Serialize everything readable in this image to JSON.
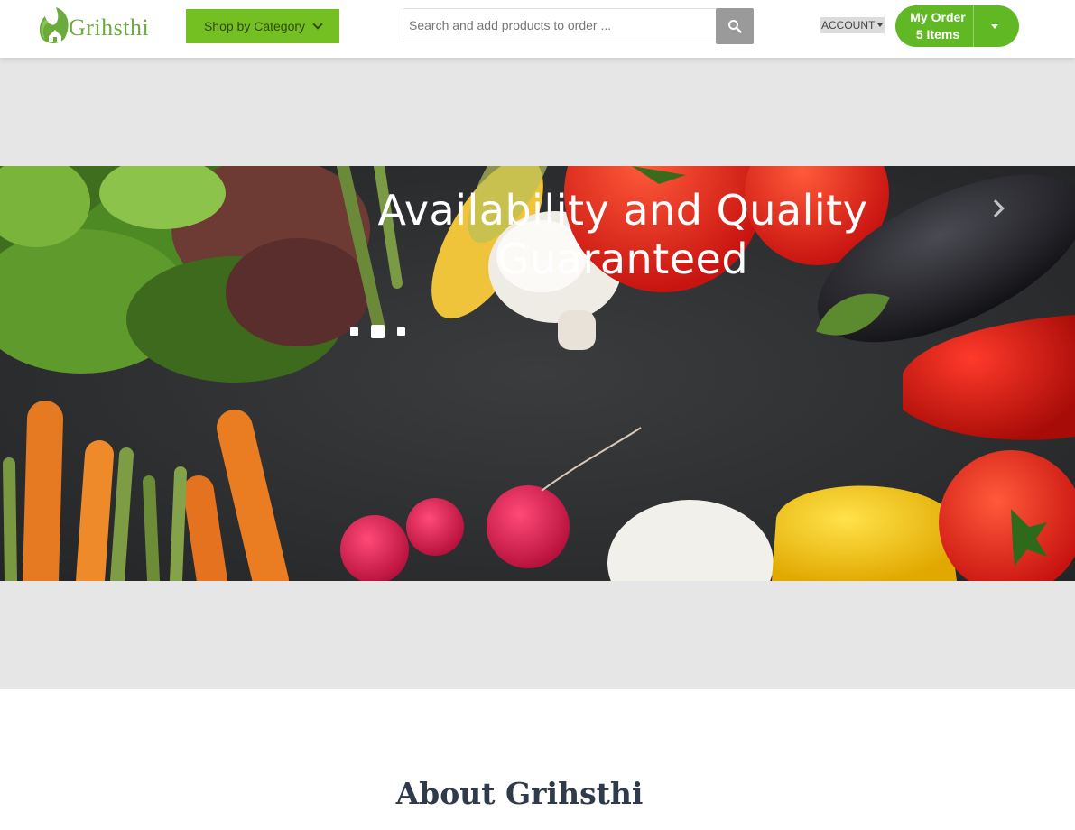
{
  "header": {
    "logo_text": "Grihsthi",
    "category_button": "Shop by Category",
    "search": {
      "placeholder": "Search and add products to order ..."
    },
    "account_label": "ACCOUNT",
    "order": {
      "line1": "My Order",
      "line2": "5 Items"
    }
  },
  "hero": {
    "caption_line1": "Availability and Quality",
    "caption_line2": "Guaranteed",
    "active_slide": 2,
    "slide_count": 3
  },
  "about": {
    "title": "About Grihsthi"
  },
  "colors": {
    "brand_green": "#74c023",
    "order_green": "#5fb824",
    "search_button": "#9a9a9a",
    "band_grey": "#e6e6e6"
  },
  "icons": [
    "leaf-house-logo-icon",
    "chevron-down-icon",
    "search-icon",
    "caret-down-icon",
    "chevron-right-icon"
  ]
}
